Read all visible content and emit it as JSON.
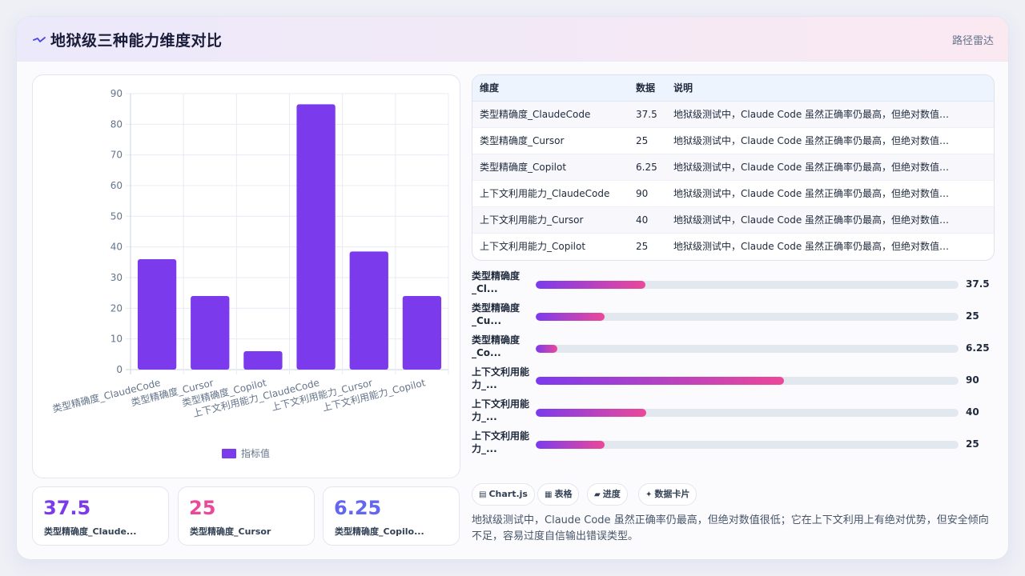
{
  "header": {
    "title": "地狱级三种能力维度对比",
    "subtitle": "路径雷达",
    "icon": "pulse-icon"
  },
  "colors": {
    "accent": "#7c3aed",
    "pink": "#ec4899",
    "indigo": "#6366f1"
  },
  "chart_data": {
    "type": "bar",
    "categories": [
      "类型精确度_ClaudeCode",
      "类型精确度_Cursor",
      "类型精确度_Copilot",
      "上下文利用能力_ClaudeCode",
      "上下文利用能力_Cursor",
      "上下文利用能力_Copilot"
    ],
    "series": [
      {
        "name": "指标值",
        "values": [
          36,
          24,
          6,
          86.5,
          38.5,
          24
        ]
      }
    ],
    "ylim": [
      0,
      90
    ],
    "yticks": [
      0,
      10,
      20,
      30,
      40,
      50,
      60,
      70,
      80,
      90
    ],
    "grid": true,
    "legend": "bottom",
    "color": "#7c3aed"
  },
  "kpis": [
    {
      "value": "37.5",
      "label": "类型精确度_Claude...",
      "color": "#7c3aed"
    },
    {
      "value": "25",
      "label": "类型精确度_Cursor",
      "color": "#ec4899"
    },
    {
      "value": "6.25",
      "label": "类型精确度_Copilo...",
      "color": "#6366f1"
    }
  ],
  "table": {
    "headers": [
      "维度",
      "数据",
      "说明"
    ],
    "rows": [
      {
        "dim": "类型精确度_ClaudeCode",
        "value": "37.5",
        "note": "地狱级测试中，Claude Code 虽然正确率仍最高，但绝对数值很..."
      },
      {
        "dim": "类型精确度_Cursor",
        "value": "25",
        "note": "地狱级测试中，Claude Code 虽然正确率仍最高，但绝对数值很..."
      },
      {
        "dim": "类型精确度_Copilot",
        "value": "6.25",
        "note": "地狱级测试中，Claude Code 虽然正确率仍最高，但绝对数值很..."
      },
      {
        "dim": "上下文利用能力_ClaudeCode",
        "value": "90",
        "note": "地狱级测试中，Claude Code 虽然正确率仍最高，但绝对数值很..."
      },
      {
        "dim": "上下文利用能力_Cursor",
        "value": "40",
        "note": "地狱级测试中，Claude Code 虽然正确率仍最高，但绝对数值很..."
      },
      {
        "dim": "上下文利用能力_Copilot",
        "value": "25",
        "note": "地狱级测试中，Claude Code 虽然正确率仍最高，但绝对数值很..."
      }
    ]
  },
  "progress": [
    {
      "line1": "类型精确度",
      "line2": "_Cl...",
      "value": "37.5",
      "fraction": 0.26
    },
    {
      "line1": "类型精确度",
      "line2": "_Cu...",
      "value": "25",
      "fraction": 0.162
    },
    {
      "line1": "类型精确度",
      "line2": "_Co...",
      "value": "6.25",
      "fraction": 0.051
    },
    {
      "line1": "上下文利用能",
      "line2": "力_...",
      "value": "90",
      "fraction": 0.587
    },
    {
      "line1": "上下文利用能",
      "line2": "力_...",
      "value": "40",
      "fraction": 0.261
    },
    {
      "line1": "上下文利用能",
      "line2": "力_...",
      "value": "25",
      "fraction": 0.162
    }
  ],
  "chips": [
    {
      "icon": "▤",
      "label": "Chart.js"
    },
    {
      "icon": "▦",
      "label": "表格"
    },
    {
      "icon": "▰",
      "label": "进度"
    },
    {
      "icon": "✦",
      "label": "数据卡片"
    }
  ],
  "description": "地狱级测试中，Claude Code 虽然正确率仍最高，但绝对数值很低；它在上下文利用上有绝对优势，但安全倾向不足，容易过度自信输出错误类型。"
}
